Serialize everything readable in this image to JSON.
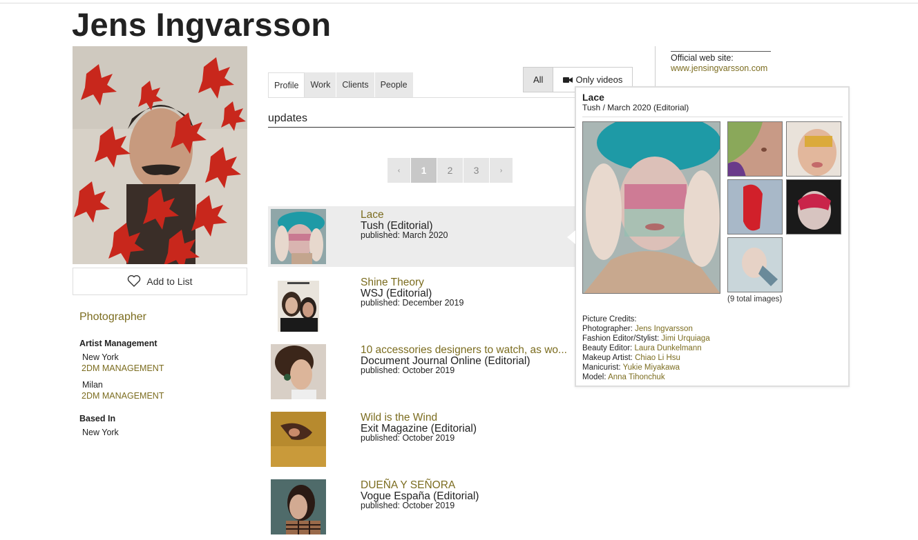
{
  "artist": {
    "name": "Jens Ingvarsson",
    "role": "Photographer",
    "add_to_list": "Add to List"
  },
  "management": {
    "heading": "Artist Management",
    "entries": [
      {
        "city": "New York",
        "agency": "2DM MANAGEMENT"
      },
      {
        "city": "Milan",
        "agency": "2DM MANAGEMENT"
      }
    ]
  },
  "based_in": {
    "heading": "Based In",
    "city": "New York"
  },
  "tabs": [
    "Profile",
    "Work",
    "Clients",
    "People"
  ],
  "filter": {
    "all": "All",
    "only_videos": "Only videos"
  },
  "updates_label": "updates",
  "pagination": {
    "prev": "‹",
    "pages": [
      "1",
      "2",
      "3"
    ],
    "next": "›",
    "current": "1"
  },
  "items": [
    {
      "title": "Lace",
      "publication": "Tush (Editorial)",
      "published": "published: March 2020"
    },
    {
      "title": "Shine Theory",
      "publication": "WSJ (Editorial)",
      "published": "published: December 2019"
    },
    {
      "title": "10 accessories designers to watch, as wo...",
      "publication": "Document Journal Online (Editorial)",
      "published": "published: October 2019"
    },
    {
      "title": "Wild is the Wind",
      "publication": "Exit Magazine (Editorial)",
      "published": "published: October 2019"
    },
    {
      "title": "DUEÑA Y SEÑORA",
      "publication": "Vogue España (Editorial)",
      "published": "published: October 2019"
    }
  ],
  "website": {
    "label": "Official web site:",
    "url": "www.jensingvarsson.com"
  },
  "popup": {
    "title": "Lace",
    "subtitle": "Tush / March 2020 (Editorial)",
    "total_images": "(9 total images)",
    "credits_heading": "Picture Credits:",
    "credits": [
      {
        "role": "Photographer:",
        "name": "Jens Ingvarsson"
      },
      {
        "role": "Fashion Editor/Stylist:",
        "name": "Jimi Urquiaga"
      },
      {
        "role": "Beauty Editor:",
        "name": "Laura Dunkelmann"
      },
      {
        "role": "Makeup Artist:",
        "name": "Chiao Li Hsu"
      },
      {
        "role": "Manicurist:",
        "name": "Yukie Miyakawa"
      },
      {
        "role": "Model:",
        "name": "Anna Tihonchuk"
      }
    ]
  },
  "colors": {
    "accent": "#7b6c1f",
    "text": "#222222",
    "highlight_row": "#ececec"
  }
}
